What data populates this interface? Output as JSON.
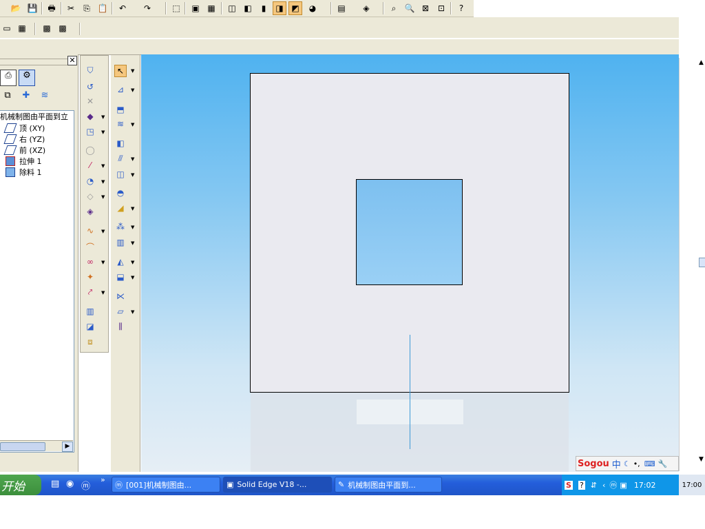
{
  "colors": {
    "accent": "#245edb",
    "canvas_top": "#4fb2f0",
    "sheet": "#eaeaf0",
    "hole": "#86c8f2"
  },
  "toolbar_main": {
    "icons": [
      "open-icon",
      "save-icon",
      "print-icon",
      "cut-icon",
      "copy-icon",
      "paste-icon",
      "undo-icon",
      "redo-icon",
      "back-icon",
      "view-icon",
      "fit-icon",
      "iso-view-icon",
      "cube-view-icon",
      "shaded-icon",
      "shaded-edges-icon",
      "render-icon",
      "globe-icon",
      "layer-icon",
      "display-icon",
      "zoom-area-icon",
      "zoom-icon",
      "fit-all-icon",
      "pan-icon",
      "help-icon"
    ]
  },
  "feature_tree": {
    "title": "机械制图由平面到立",
    "items": [
      {
        "label": "顶 (XY)",
        "icon": "plane-icon"
      },
      {
        "label": "右 (YZ)",
        "icon": "plane-icon"
      },
      {
        "label": "前 (XZ)",
        "icon": "plane-icon"
      },
      {
        "label": "拉伸 1",
        "icon": "extrude-icon"
      },
      {
        "label": "除料 1",
        "icon": "cutout-icon"
      }
    ]
  },
  "ime": {
    "logo": "Sogou",
    "mode": "中"
  },
  "taskbar": {
    "start_label": "开始",
    "tasks": [
      {
        "label": "[001]机械制图由..."
      },
      {
        "label": "Solid Edge V18 -..."
      },
      {
        "label": "机械制图由平面到..."
      }
    ],
    "clock": "17:02",
    "clock2": "17:00"
  }
}
